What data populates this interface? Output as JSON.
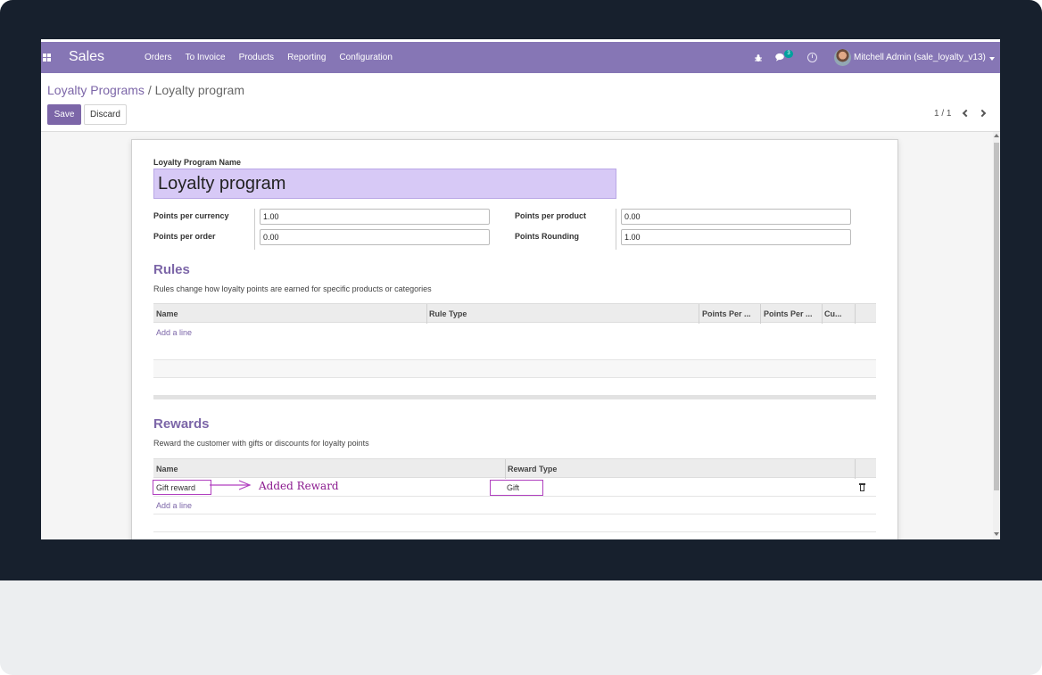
{
  "navbar": {
    "app_name": "Sales",
    "menu": [
      "Orders",
      "To Invoice",
      "Products",
      "Reporting",
      "Configuration"
    ],
    "chat_count": "3",
    "user": "Mitchell Admin (sale_loyalty_v13)"
  },
  "breadcrumb": {
    "parent": "Loyalty Programs",
    "separator": "/",
    "current": "Loyalty program"
  },
  "buttons": {
    "save": "Save",
    "discard": "Discard"
  },
  "pager": {
    "value": "1 / 1"
  },
  "form": {
    "name_label": "Loyalty Program Name",
    "name_value": "Loyalty program",
    "points_per_currency_label": "Points per currency",
    "points_per_currency": "1.00",
    "points_per_order_label": "Points per order",
    "points_per_order": "0.00",
    "points_per_product_label": "Points per product",
    "points_per_product": "0.00",
    "points_rounding_label": "Points Rounding",
    "points_rounding": "1.00"
  },
  "rules": {
    "title": "Rules",
    "help": "Rules change how loyalty points are earned for specific products or categories",
    "columns": [
      "Name",
      "Rule Type",
      "Points Per ...",
      "Points Per ...",
      "Cu..."
    ],
    "add_line": "Add a line"
  },
  "rewards": {
    "title": "Rewards",
    "help": "Reward the customer with gifts or discounts for loyalty points",
    "columns": [
      "Name",
      "Reward Type"
    ],
    "rows": [
      {
        "name": "Gift reward",
        "type": "Gift"
      }
    ],
    "add_line": "Add a line",
    "annotation": "Added Reward"
  },
  "colors": {
    "navbar": "#8676b5",
    "accent": "#7c66a8",
    "name_field_bg": "#d7c9f6",
    "annotation": "#b03fbf"
  }
}
